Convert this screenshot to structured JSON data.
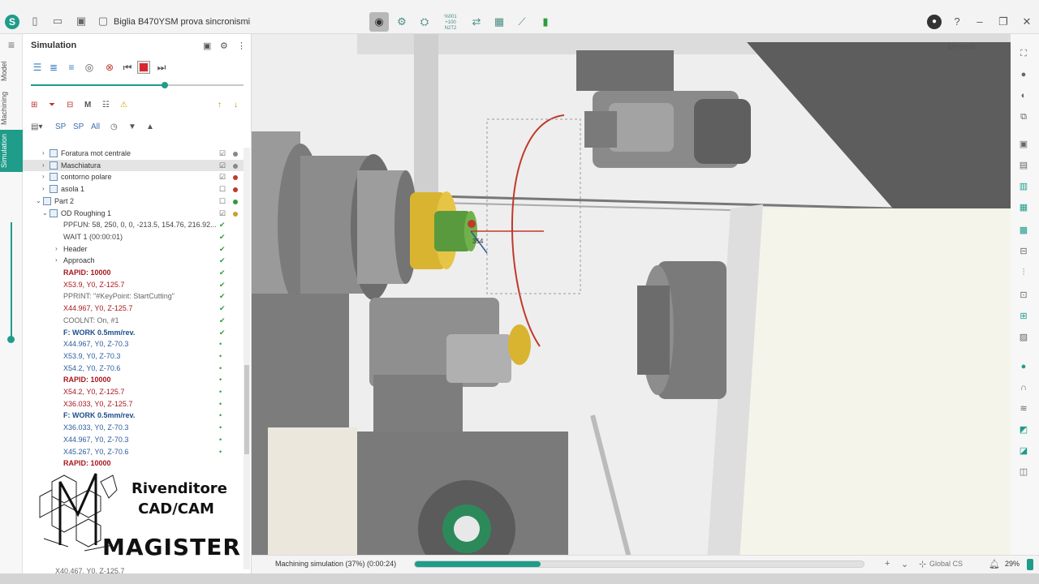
{
  "window": {
    "title": "Biglia B470YSM prova sincronismi"
  },
  "titlebar": {
    "file_icons": [
      "new-file-icon",
      "open-folder-icon",
      "save-icon",
      "document-icon"
    ],
    "center_tools": [
      "simulation-icon",
      "machine-view-icon",
      "tool-icon",
      "nc-code-icon",
      "sync-icon",
      "table-icon",
      "chart-icon",
      "stock-icon"
    ],
    "nc_code_label": "%001\n+100\nN2T2",
    "right_icons": [
      "avatar-icon",
      "help-icon",
      "minimize-icon",
      "restore-icon",
      "close-icon"
    ]
  },
  "side_tabs": [
    "Model",
    "Machining",
    "Simulation"
  ],
  "panel": {
    "title": "Simulation",
    "toolbar_row2": [
      "SP",
      "SP",
      "All"
    ],
    "tool_m_label": "M"
  },
  "tree": [
    {
      "label": "Foratura mot centrale",
      "indent": 2,
      "style": "op",
      "arrow": "›",
      "icon": true,
      "chk": "☑",
      "dot": "#888888"
    },
    {
      "label": "Maschiatura",
      "indent": 2,
      "style": "op",
      "arrow": "›",
      "icon": true,
      "chk": "☑",
      "dot": "#888888",
      "selected": true
    },
    {
      "label": "contorno polare",
      "indent": 2,
      "style": "op",
      "arrow": "›",
      "icon": true,
      "chk": "☑",
      "dot": "#c0392b"
    },
    {
      "label": "asola 1",
      "indent": 2,
      "style": "op",
      "arrow": "›",
      "icon": true,
      "chk": "☐",
      "dot": "#c0392b"
    },
    {
      "label": "Part 2",
      "indent": 1,
      "style": "op",
      "arrow": "⌄",
      "icon": true,
      "chk": "☐",
      "dot": "#2f9a3b"
    },
    {
      "label": "OD Roughing 1",
      "indent": 2,
      "style": "op",
      "arrow": "⌄",
      "icon": true,
      "chk": "☑",
      "dot": "#c8a032"
    },
    {
      "label": "PPFUN: 58, 250, 0, 0, -213.5, 154.76, 216.92...",
      "indent": 3,
      "style": "normal",
      "chk": "✔"
    },
    {
      "label": "WAIT 1 (00:00:01)",
      "indent": 3,
      "style": "normal",
      "chk": "✔"
    },
    {
      "label": "Header",
      "indent": 3,
      "style": "op",
      "arrow": "›",
      "chk": "✔"
    },
    {
      "label": "Approach",
      "indent": 3,
      "style": "op",
      "arrow": "›",
      "chk": "✔"
    },
    {
      "label": "RAPID: 10000",
      "indent": 3,
      "style": "rapid",
      "chk": "✔"
    },
    {
      "label": "X53.9, Y0, Z-125.7",
      "indent": 3,
      "style": "red",
      "chk": "✔"
    },
    {
      "label": "PPRINT: \"#KeyPoint: StartCutting\"",
      "indent": 3,
      "style": "gray",
      "chk": "✔"
    },
    {
      "label": "X44.967, Y0, Z-125.7",
      "indent": 3,
      "style": "red",
      "chk": "✔"
    },
    {
      "label": "COOLNT: On, #1",
      "indent": 3,
      "style": "gray",
      "chk": "✔"
    },
    {
      "label": "F: WORK 0.5mm/rev.",
      "indent": 3,
      "style": "work",
      "chk": "✔"
    },
    {
      "label": "X44.967, Y0, Z-70.3",
      "indent": 3,
      "style": "blue",
      "chk": "•"
    },
    {
      "label": "X53.9, Y0, Z-70.3",
      "indent": 3,
      "style": "blue",
      "chk": "•"
    },
    {
      "label": "X54.2, Y0, Z-70.6",
      "indent": 3,
      "style": "blue",
      "chk": "•"
    },
    {
      "label": "RAPID: 10000",
      "indent": 3,
      "style": "rapid",
      "chk": "•"
    },
    {
      "label": "X54.2, Y0, Z-125.7",
      "indent": 3,
      "style": "red",
      "chk": "•"
    },
    {
      "label": "X36.033, Y0, Z-125.7",
      "indent": 3,
      "style": "red",
      "chk": "•"
    },
    {
      "label": "F: WORK 0.5mm/rev.",
      "indent": 3,
      "style": "work",
      "chk": "•"
    },
    {
      "label": "X36.033, Y0, Z-70.3",
      "indent": 3,
      "style": "blue",
      "chk": "•"
    },
    {
      "label": "X44.967, Y0, Z-70.3",
      "indent": 3,
      "style": "blue",
      "chk": "•"
    },
    {
      "label": "X45.267, Y0, Z-70.6",
      "indent": 3,
      "style": "blue",
      "chk": "•"
    },
    {
      "label": "RAPID: 10000",
      "indent": 3,
      "style": "rapid",
      "chk": ""
    }
  ],
  "tree_last_row": "X40.467, Y0, Z-125.7",
  "watermark": {
    "line1": "Rivenditore",
    "line2": "CAD/CAM",
    "line3": "MAGISTER"
  },
  "viewport": {
    "view_mode": "Dynamic",
    "dimension_label": "354"
  },
  "status": {
    "text": "Machining simulation (37%) (0:00:24)",
    "progress": 0.28,
    "cs_label": "Global CS",
    "zoom": "29%"
  },
  "slider_position": 0.63,
  "accent_color": "#1f9c8a"
}
